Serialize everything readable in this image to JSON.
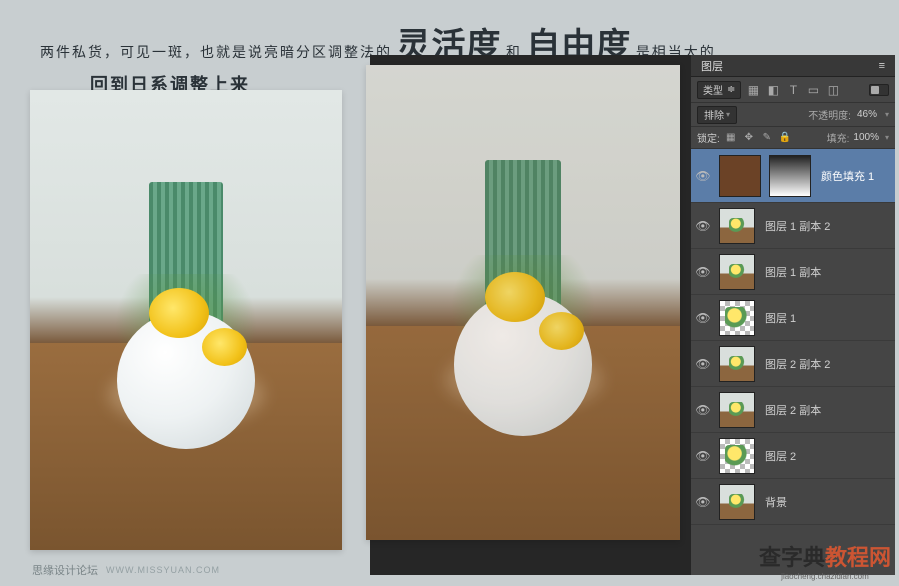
{
  "headline": {
    "prefix": "两件私货，可见一斑，也就是说亮暗分区调整法的",
    "big1": "灵活度",
    "and": "和",
    "big2": "自由度",
    "suffix": "是相当大的",
    "line2": "回到日系调整上来"
  },
  "panel": {
    "tab": "图层",
    "kind_label": "类型",
    "kind_chev": "≑",
    "icons": {
      "img": "▦",
      "fx": "◧",
      "txt": "T",
      "shape": "▭",
      "smart": "◫"
    },
    "blend_mode": "排除",
    "opacity_label": "不透明度:",
    "opacity_value": "46%",
    "lock_label": "锁定:",
    "lock_icons": {
      "img": "▦",
      "pos": "✥",
      "brush": "✎",
      "lock": "🔒"
    },
    "fill_label": "填充:",
    "fill_value": "100%"
  },
  "layers": [
    {
      "name": "颜色填充 1",
      "visible": true,
      "type": "fill",
      "selected": true
    },
    {
      "name": "图层 1 副本 2",
      "visible": true,
      "type": "photo"
    },
    {
      "name": "图层 1 副本",
      "visible": true,
      "type": "photo"
    },
    {
      "name": "图层 1",
      "visible": true,
      "type": "checker"
    },
    {
      "name": "图层 2 副本 2",
      "visible": true,
      "type": "photo"
    },
    {
      "name": "图层 2 副本",
      "visible": true,
      "type": "photo"
    },
    {
      "name": "图层 2",
      "visible": true,
      "type": "checker"
    },
    {
      "name": "背景",
      "visible": true,
      "type": "photo",
      "cut": true
    }
  ],
  "watermark": {
    "site": "思缘设计论坛",
    "url": "WWW.MISSYUAN.COM"
  },
  "brand": {
    "main_a": "查字典",
    "main_b": "教程网",
    "sub": "jiaocheng.chazidian.com"
  }
}
